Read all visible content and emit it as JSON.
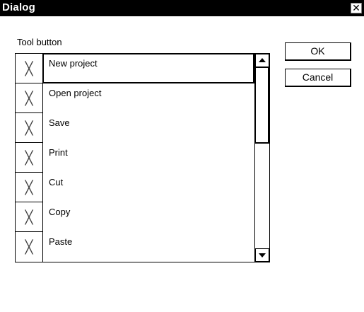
{
  "window": {
    "title": "Dialog",
    "close_glyph": "✕"
  },
  "group": {
    "label": "Tool button"
  },
  "list": {
    "items": [
      {
        "check": "╳",
        "label": "New project",
        "selected": true
      },
      {
        "check": "╳",
        "label": "Open project",
        "selected": false
      },
      {
        "check": "╳",
        "label": "Save",
        "selected": false
      },
      {
        "check": "╳",
        "label": "Print",
        "selected": false
      },
      {
        "check": "╳",
        "label": "Cut",
        "selected": false
      },
      {
        "check": "╳",
        "label": "Copy",
        "selected": false
      },
      {
        "check": "╳",
        "label": "Paste",
        "selected": false
      }
    ]
  },
  "buttons": {
    "ok": "OK",
    "cancel": "Cancel"
  }
}
